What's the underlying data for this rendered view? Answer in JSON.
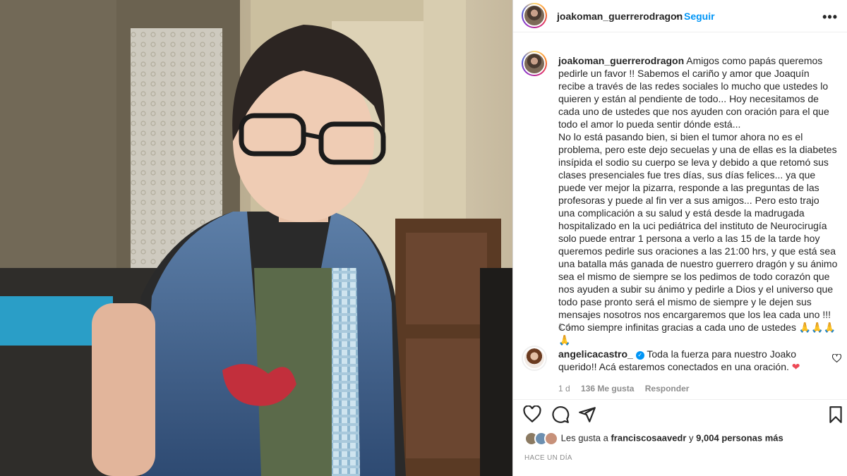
{
  "post": {
    "username": "joakoman_guerrerodragon",
    "follow_label": "Seguir",
    "dot": "•",
    "more_icon": "more-horizontal-icon",
    "caption": "Amigos como papás queremos pedirle un favor !! Sabemos el cariño y amor que Joaquín recibe a través de las redes sociales lo mucho que ustedes lo quieren y están al pendiente de todo... Hoy necesitamos de cada uno de ustedes que nos ayuden con oración para el que todo el amor lo pueda sentir dónde está...\nNo lo está pasando bien, si bien el tumor ahora no es el problema, pero este dejo secuelas y una de ellas es la diabetes insípida el sodio su cuerpo se leva y debido a que retomó sus clases presenciales fue tres días, sus días felices... ya que puede ver mejor la pizarra, responde a las preguntas de las profesoras y puede al fin ver a sus amigos... Pero esto trajo una complicación a su salud y está desde la madrugada hospitalizado en la uci pediátrica del instituto de Neurocirugía solo puede entrar 1 persona a verlo a las 15 de la tarde hoy queremos pedirle sus oraciones a las 21:00 hrs, y que está sea una batalla más ganada de nuestro guerrero dragón y su ánimo sea el mismo de siempre se los pedimos de todo corazón que nos ayuden a subir su ánimo y pedirle a Dios y el universo que todo pase pronto será el mismo de siempre y le dejen sus mensajes nosotros nos encargaremos que los lea cada uno !!!\nCómo siempre infinitas gracias a cada uno de ustedes 🙏🙏🙏🙏",
    "caption_age": "1 d"
  },
  "comment": {
    "username": "angelicacastro_",
    "text": "Toda la fuerza para nuestro Joako querido!! Acá estaremos conectados en una oración. ",
    "heart": "❤",
    "age": "1 d",
    "likes": "136 Me gusta",
    "reply_label": "Responder"
  },
  "likes": {
    "prefix": "Les gusta a",
    "user": "franciscosaavedr",
    "middle": "y",
    "count": "9,004 personas más"
  },
  "timestamp": "HACE UN DÍA",
  "colors": {
    "accent": "#0095f6",
    "heart": "#ed4956",
    "muted": "#8e8e8e",
    "text": "#262626"
  }
}
